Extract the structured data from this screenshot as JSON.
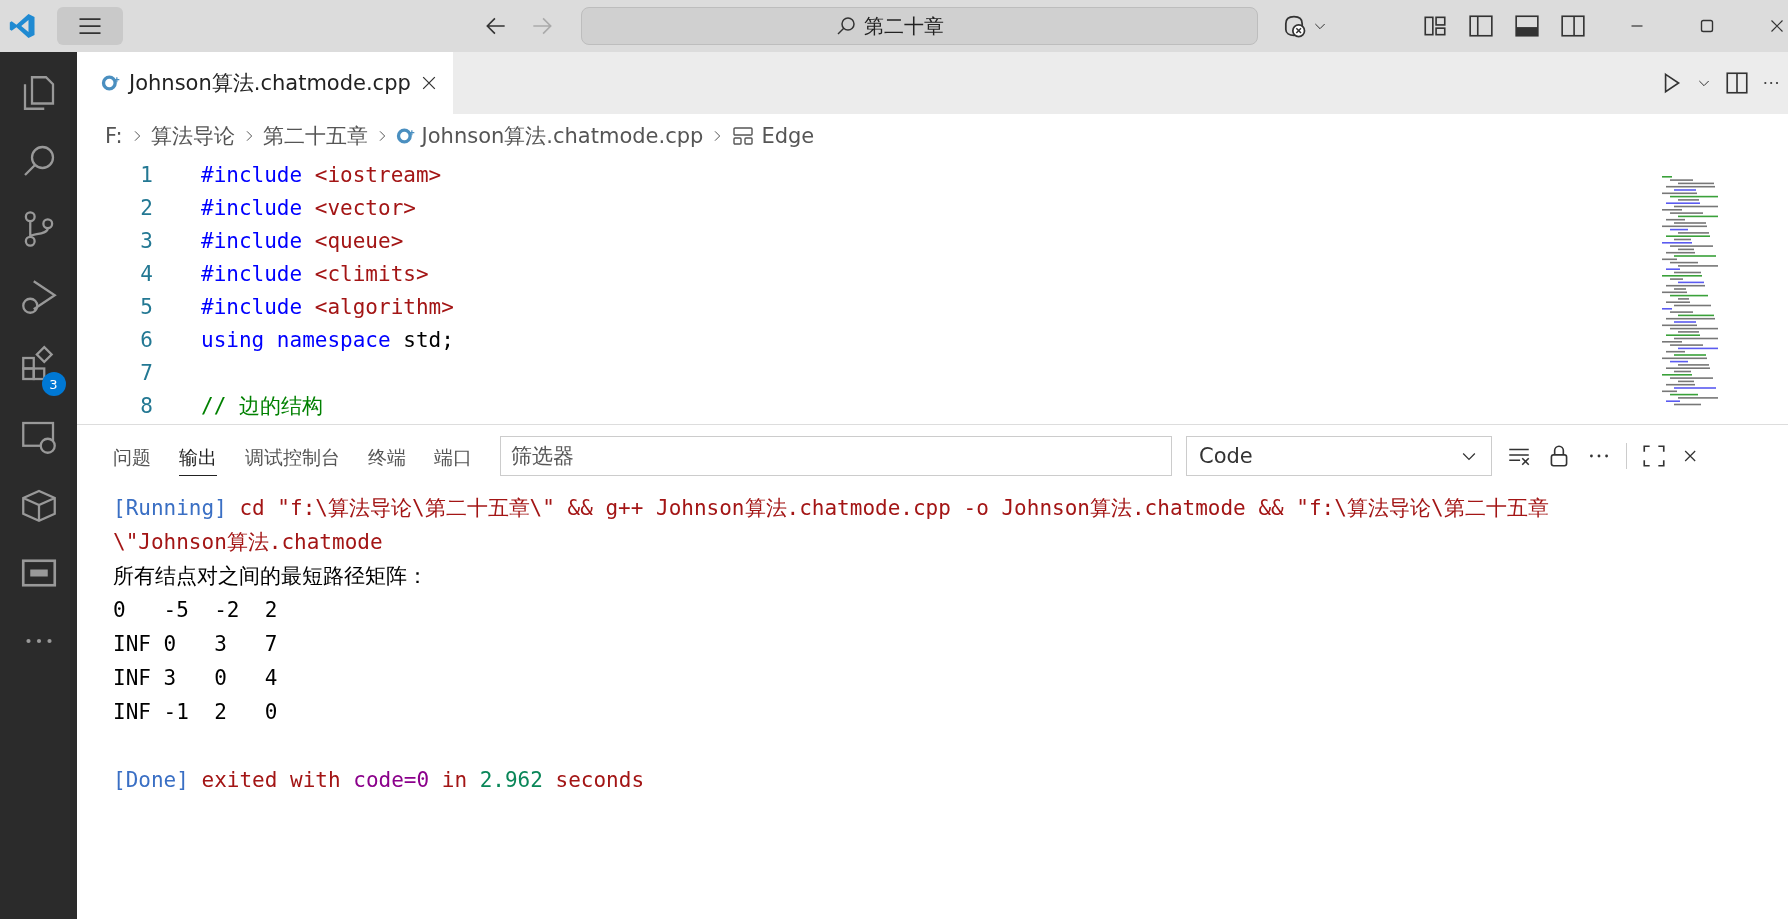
{
  "title_bar": {
    "search": "第二十章"
  },
  "activity_bar": {
    "extensions_badge": "3"
  },
  "tabs": [
    {
      "label": "Johnson算法.chatmode.cpp",
      "selected": true
    }
  ],
  "breadcrumb": [
    "F:",
    "算法导论",
    "第二十五章",
    "Johnson算法.chatmode.cpp",
    "Edge"
  ],
  "code_lines": [
    {
      "number": "1",
      "tokens": [
        {
          "text": "#include ",
          "kind": "keyword"
        },
        {
          "text": "<iostream>",
          "kind": "string"
        }
      ]
    },
    {
      "number": "2",
      "tokens": [
        {
          "text": "#include ",
          "kind": "keyword"
        },
        {
          "text": "<vector>",
          "kind": "string"
        }
      ]
    },
    {
      "number": "3",
      "tokens": [
        {
          "text": "#include ",
          "kind": "keyword"
        },
        {
          "text": "<queue>",
          "kind": "string"
        }
      ]
    },
    {
      "number": "4",
      "tokens": [
        {
          "text": "#include ",
          "kind": "keyword"
        },
        {
          "text": "<climits>",
          "kind": "string"
        }
      ]
    },
    {
      "number": "5",
      "tokens": [
        {
          "text": "#include ",
          "kind": "keyword"
        },
        {
          "text": "<algorithm>",
          "kind": "string"
        }
      ]
    },
    {
      "number": "6",
      "tokens": [
        {
          "text": "using namespace ",
          "kind": "keyword"
        },
        {
          "text": "std;",
          "kind": "plain"
        }
      ]
    },
    {
      "number": "7"
    },
    {
      "number": "8",
      "tokens": [
        {
          "text": "// 边的结构",
          "kind": "comment"
        }
      ]
    }
  ],
  "panel": {
    "tabs": [
      {
        "label": "问题",
        "selected": false
      },
      {
        "label": "输出",
        "selected": true
      },
      {
        "label": "调试控制台",
        "selected": false
      },
      {
        "label": "终端",
        "selected": false
      },
      {
        "label": "端口",
        "selected": false
      }
    ],
    "filter": {
      "placeholder": "筛选器"
    },
    "channel": "Code",
    "output_lines": [
      {
        "tokens": [
          {
            "text": "[Running]",
            "kind": "tag"
          },
          {
            "text": " cd \"f:\\算法导论\\第二十五章\\\" && g++ Johnson算法.chatmode.cpp -o Johnson算法.chatmode && \"f:\\算法导论\\第二十五章",
            "kind": "command"
          }
        ]
      },
      {
        "tokens": [
          {
            "text": "\\\"Johnson算法.chatmode",
            "kind": "command"
          }
        ]
      },
      {
        "tokens": [
          {
            "text": "所有结点对之间的最短路径矩阵：",
            "kind": "plain"
          }
        ]
      },
      {
        "tokens": [
          {
            "text": "0   -5  -2  2",
            "kind": "plain"
          }
        ]
      },
      {
        "tokens": [
          {
            "text": "INF 0   3   7",
            "kind": "plain"
          }
        ]
      },
      {
        "tokens": [
          {
            "text": "INF 3   0   4",
            "kind": "plain"
          }
        ]
      },
      {
        "tokens": [
          {
            "text": "INF -1  2   0",
            "kind": "plain"
          }
        ]
      },
      {
        "kind": "blank"
      },
      {
        "tokens": [
          {
            "text": "[Done]",
            "kind": "tag"
          },
          {
            "text": " exited with ",
            "kind": "command"
          },
          {
            "text": "code=0",
            "kind": "code"
          },
          {
            "text": " in ",
            "kind": "command"
          },
          {
            "text": "2.962",
            "kind": "number"
          },
          {
            "text": " seconds",
            "kind": "command"
          }
        ]
      }
    ]
  }
}
